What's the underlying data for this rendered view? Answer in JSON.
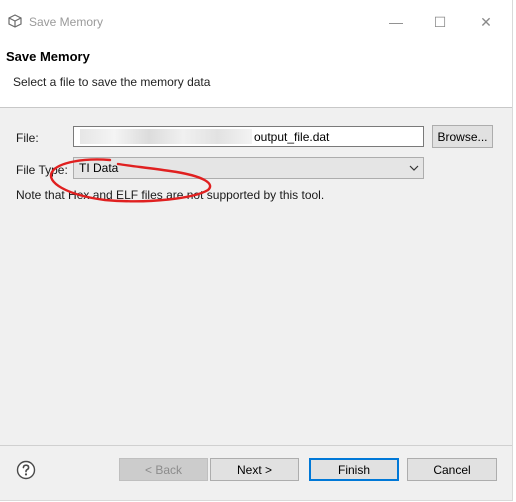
{
  "window": {
    "title": "Save Memory",
    "minimize_glyph": "—",
    "maximize_glyph": "☐",
    "close_glyph": "✕"
  },
  "header": {
    "title": "Save Memory",
    "subtitle": "Select a file to save the memory data"
  },
  "form": {
    "file_label": "File:",
    "file_value": "output_file.dat",
    "browse_label": "Browse...",
    "file_type_label": "File Type:",
    "file_type_value": "TI Data",
    "note": "Note that Hex and ELF files are not supported by this tool."
  },
  "buttons": {
    "back": "< Back",
    "next": "Next >",
    "finish": "Finish",
    "cancel": "Cancel"
  },
  "icons": {
    "app": "eclipse-cube-icon",
    "help": "help-icon",
    "dropdown": "chevron-down-icon"
  },
  "colors": {
    "annotation": "#e02020",
    "accent": "#0078d7"
  }
}
